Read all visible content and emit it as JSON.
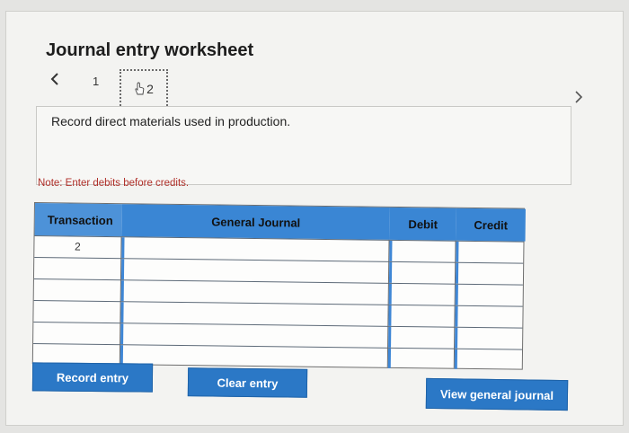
{
  "worksheet": {
    "title": "Journal entry worksheet",
    "steps": [
      "1",
      "2"
    ],
    "instruction": "Record direct materials used in production.",
    "note": "Note: Enter debits before credits."
  },
  "journal": {
    "headers": {
      "transaction": "Transaction",
      "general_journal": "General Journal",
      "debit": "Debit",
      "credit": "Credit"
    },
    "rows": [
      {
        "transaction": "2",
        "account": "",
        "debit": "",
        "credit": ""
      },
      {
        "transaction": "",
        "account": "",
        "debit": "",
        "credit": ""
      },
      {
        "transaction": "",
        "account": "",
        "debit": "",
        "credit": ""
      },
      {
        "transaction": "",
        "account": "",
        "debit": "",
        "credit": ""
      },
      {
        "transaction": "",
        "account": "",
        "debit": "",
        "credit": ""
      },
      {
        "transaction": "",
        "account": "",
        "debit": "",
        "credit": ""
      }
    ]
  },
  "buttons": {
    "record": "Record entry",
    "clear": "Clear entry",
    "view": "View general journal"
  },
  "colors": {
    "accent": "#2b78c6",
    "header": "#3a86d4",
    "note": "#b0302a"
  },
  "icons": {
    "prev": "chevron-left-icon",
    "next": "chevron-right-icon",
    "cursor": "hand-pointer-icon"
  }
}
